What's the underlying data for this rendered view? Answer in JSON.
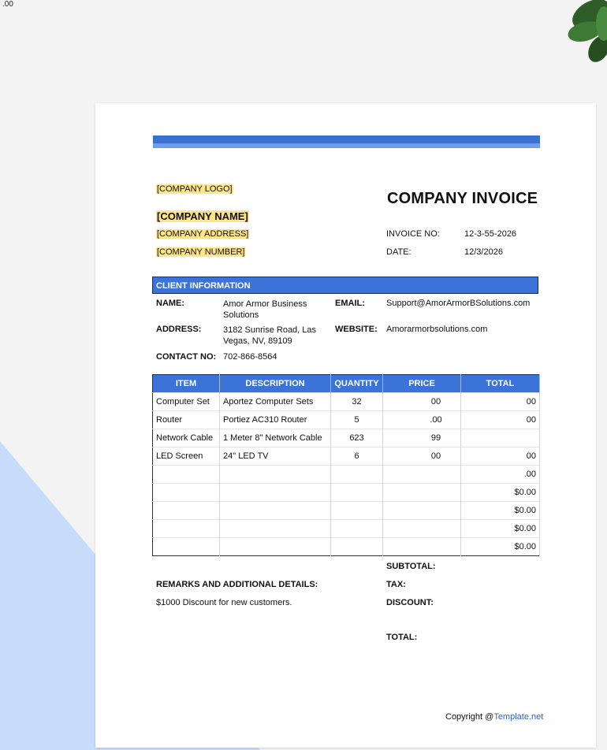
{
  "corner_text": ".00",
  "invoice": {
    "title": "COMPANY INVOICE",
    "company_logo": "[COMPANY LOGO]",
    "company_name": "[COMPANY NAME]",
    "company_address": "[COMPANY ADDRESS]",
    "company_number": "[COMPANY NUMBER]",
    "invoice_no_label": "INVOICE NO:",
    "invoice_no": "12-3-55-2026",
    "date_label": "DATE:",
    "date": "12/3/2026"
  },
  "client": {
    "heading": "CLIENT INFORMATION",
    "name_label": "NAME:",
    "name_line1": "Amor Armor Business",
    "name_line2": "Solutions",
    "email_label": "EMAIL:",
    "email": "Support@AmorArmorBSolutions.com",
    "address_label": "ADDRESS:",
    "address_line1": "3182 Sunrise Road, Las",
    "address_line2": "Vegas, NV, 89109",
    "website_label": "WEBSITE:",
    "website": "Amorarmorbsolutions.com",
    "contact_label": "CONTACT NO:",
    "contact": "702-866-8564"
  },
  "table": {
    "headers": [
      "ITEM",
      "DESCRIPTION",
      "QUANTITY",
      "PRICE",
      "TOTAL"
    ],
    "rows": [
      {
        "item": "Computer Set",
        "description": "Aportez Computer Sets",
        "quantity": "32",
        "price": "00",
        "total": "00"
      },
      {
        "item": "Router",
        "description": "Portiez AC310 Router",
        "quantity": "5",
        "price": ".00",
        "total": "00"
      },
      {
        "item": "Network Cable",
        "description": "1 Meter 8\" Network Cable",
        "quantity": "623",
        "price": "99",
        "total": ""
      },
      {
        "item": "LED Screen",
        "description": "24\" LED TV",
        "quantity": "6",
        "price": "00",
        "total": "00"
      },
      {
        "item": "",
        "description": "",
        "quantity": "",
        "price": "",
        "total": ".00"
      },
      {
        "item": "",
        "description": "",
        "quantity": "",
        "price": "",
        "total": "$0.00"
      },
      {
        "item": "",
        "description": "",
        "quantity": "",
        "price": "",
        "total": "$0.00"
      },
      {
        "item": "",
        "description": "",
        "quantity": "",
        "price": "",
        "total": "$0.00"
      },
      {
        "item": "",
        "description": "",
        "quantity": "",
        "price": "",
        "total": "$0.00"
      }
    ]
  },
  "totals": {
    "subtotal_label": "SUBTOTAL:",
    "tax_label": "TAX:",
    "discount_label": "DISCOUNT:",
    "total_label": "TOTAL:"
  },
  "remarks": {
    "heading": "REMARKS AND ADDITIONAL DETAILS:",
    "text": "$1000 Discount for new customers."
  },
  "footer": {
    "copyright_prefix": "Copyright @",
    "copyright_link": "Template.net"
  },
  "colors": {
    "accent": "#3b73d8",
    "highlight": "#ffe48a",
    "background_triangle": "#c7dbfb"
  }
}
